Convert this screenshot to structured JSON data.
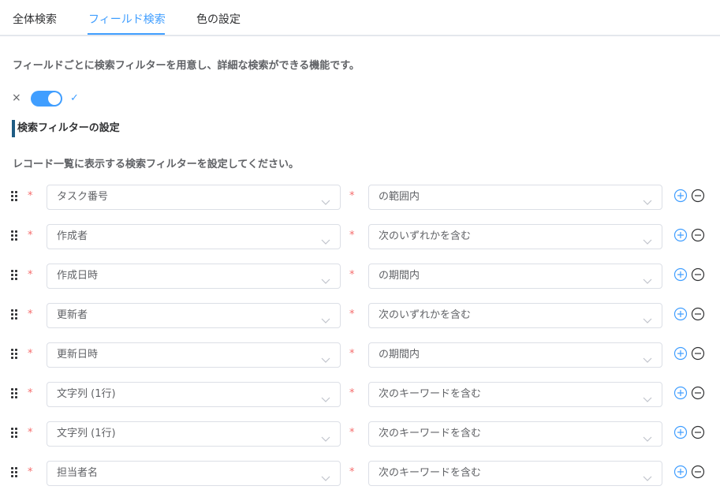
{
  "tabs": [
    {
      "label": "全体検索",
      "active": false
    },
    {
      "label": "フィールド検索",
      "active": true
    },
    {
      "label": "色の設定",
      "active": false
    }
  ],
  "description": "フィールドごとに検索フィルターを用意し、詳細な検索ができる機能です。",
  "toggle": {
    "off_symbol": "×",
    "on_symbol": "✓",
    "enabled": true
  },
  "section_title": "検索フィルターの設定",
  "sub_description": "レコード一覧に表示する検索フィルターを設定してください。",
  "filters": [
    {
      "field": "タスク番号",
      "operator": "の範囲内"
    },
    {
      "field": "作成者",
      "operator": "次のいずれかを含む"
    },
    {
      "field": "作成日時",
      "operator": "の期間内"
    },
    {
      "field": "更新者",
      "operator": "次のいずれかを含む"
    },
    {
      "field": "更新日時",
      "operator": "の期間内"
    },
    {
      "field": "文字列 (1行)",
      "operator": "次のキーワードを含む"
    },
    {
      "field": "文字列 (1行)",
      "operator": "次のキーワードを含む"
    },
    {
      "field": "担当者名",
      "operator": "次のキーワードを含む"
    }
  ],
  "required_mark": "*",
  "colors": {
    "accent": "#409eff",
    "required": "#f56c6c",
    "section_bar": "#1f5c84"
  },
  "icons": {
    "drag": "drag-handle-icon",
    "chevron": "chevron-down-icon",
    "add": "plus-circle-icon",
    "remove": "minus-circle-icon"
  }
}
